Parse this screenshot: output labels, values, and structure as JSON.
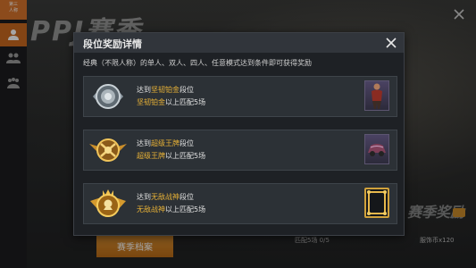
{
  "background": {
    "rail_top_label": "第三\n人称",
    "title_fragment": "PPJ赛季",
    "season_button_label": "赛季档案",
    "season_reward_label": "赛季奖励",
    "bottom_left_text": "匹配5场 0/5",
    "bottom_right_text": "服饰币x120"
  },
  "modal": {
    "title": "段位奖励详情",
    "description": "经典（不限人称）的单人、双人、四人、任意模式达到条件即可获得奖励",
    "rows": [
      {
        "prefix": "达到",
        "tier": "坚韧铂金",
        "suffix": "段位",
        "line2_tier": "坚韧铂金",
        "line2_suffix": "以上匹配5场",
        "emblem_icon": "platinum-emblem-icon",
        "reward_icon": "outfit-reward-icon"
      },
      {
        "prefix": "达到",
        "tier": "超级王牌",
        "suffix": "段位",
        "line2_tier": "超级王牌",
        "line2_suffix": "以上匹配5场",
        "emblem_icon": "ace-emblem-icon",
        "reward_icon": "vehicle-skin-reward-icon"
      },
      {
        "prefix": "达到",
        "tier": "无敌战神",
        "suffix": "段位",
        "line2_tier": "无敌战神",
        "line2_suffix": "以上匹配5场",
        "emblem_icon": "conqueror-emblem-icon",
        "reward_icon": "avatar-frame-reward-icon"
      }
    ]
  },
  "colors": {
    "accent_orange": "#d8742b",
    "highlight_gold": "#e7b136",
    "modal_bg": "#1e2125"
  }
}
